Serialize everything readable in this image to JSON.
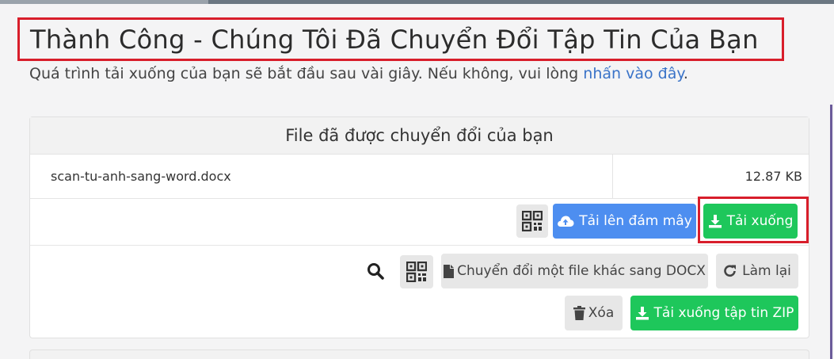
{
  "title": "Thành Công - Chúng Tôi Đã Chuyển Đổi Tập Tin Của Bạn",
  "subtitle_prefix": "Quá trình tải xuống của bạn sẽ bắt đầu sau vài giây. Nếu không, vui lòng ",
  "subtitle_link": "nhấn vào đây",
  "subtitle_suffix": ".",
  "card": {
    "header": "File đã được chuyển đổi của bạn",
    "file_name": "scan-tu-anh-sang-word.docx",
    "file_size": "12.87 KB",
    "upload_cloud_label": "Tải lên đám mây",
    "download_label": "Tải xuống"
  },
  "tools": {
    "convert_other_label": "Chuyển đổi một file khác sang DOCX",
    "redo_label": "Làm lại",
    "delete_label": "Xóa",
    "download_zip_label": "Tải xuống tập tin ZIP"
  },
  "icons": {
    "qr": "qr-code-icon",
    "cloud": "cloud-upload-icon",
    "download": "download-icon",
    "search": "search-icon",
    "file": "file-icon",
    "redo": "redo-icon",
    "trash": "trash-icon"
  },
  "colors": {
    "highlight": "#d81e2b",
    "green": "#1ec75b",
    "blue": "#4d8ef0",
    "link": "#3a73c8"
  }
}
